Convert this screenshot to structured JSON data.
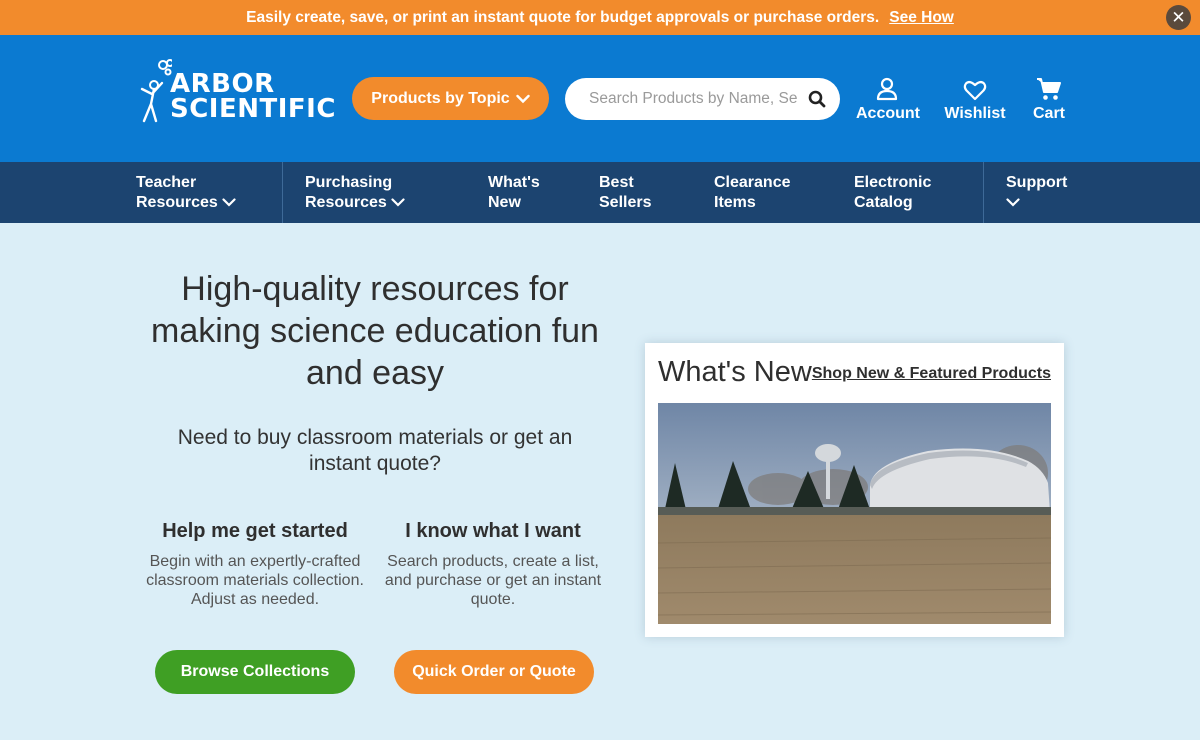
{
  "promo": {
    "text": "Easily create, save, or print an instant quote for budget approvals or purchase orders.",
    "link": "See How",
    "close": "✕"
  },
  "header": {
    "logo_line1": "ARBOR",
    "logo_line2": "SCIENTIFIC",
    "topic_button": "Products by Topic",
    "search_placeholder": "Search Products by Name, Se",
    "account": "Account",
    "wishlist": "Wishlist",
    "cart": "Cart"
  },
  "nav": {
    "items": [
      {
        "line1": "Teacher",
        "line2": "Resources"
      },
      {
        "line1": "Purchasing",
        "line2": "Resources"
      },
      {
        "line1": "What's",
        "line2": "New"
      },
      {
        "line1": "Best",
        "line2": "Sellers"
      },
      {
        "line1": "Clearance",
        "line2": "Items"
      },
      {
        "line1": "Electronic",
        "line2": "Catalog"
      },
      {
        "line1": "Support",
        "line2": ""
      }
    ]
  },
  "hero": {
    "title": "High-quality resources for making science education fun and easy",
    "subtitle": "Need to buy classroom materials or get an instant quote?",
    "col1_heading": "Help me get started",
    "col1_text": "Begin with an expertly-crafted classroom materials collection. Adjust as needed.",
    "col2_heading": "I know what I want",
    "col2_text": "Search products, create a list, and purchase or get an instant quote.",
    "btn1": "Browse Collections",
    "btn2": "Quick Order or Quote"
  },
  "whats_new": {
    "title": "What's New",
    "link": "Shop New & Featured Products"
  },
  "colors": {
    "orange": "#f28b2c",
    "blue": "#0b7ad1",
    "navy": "#1c4470",
    "green": "#3f9f24",
    "page_bg": "#dbeef7"
  }
}
